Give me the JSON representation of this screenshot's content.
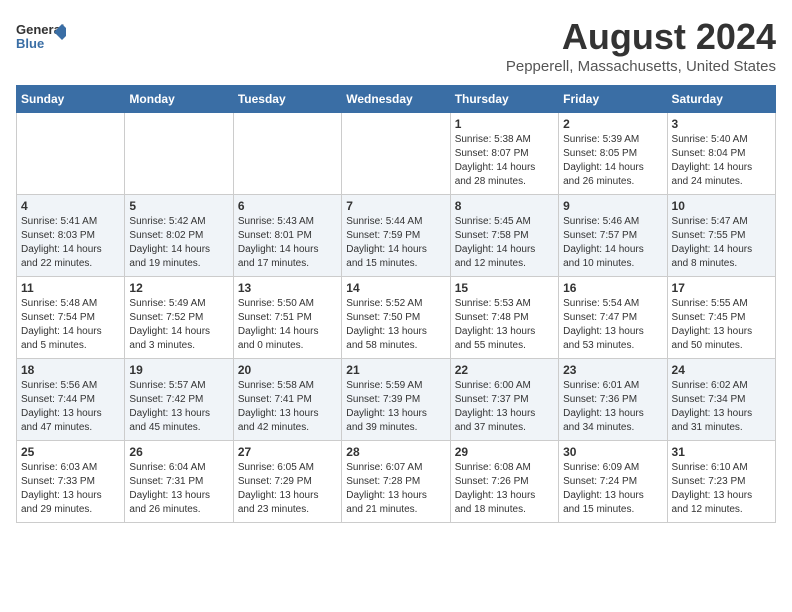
{
  "logo": {
    "text_general": "General",
    "text_blue": "Blue"
  },
  "header": {
    "title": "August 2024",
    "subtitle": "Pepperell, Massachusetts, United States"
  },
  "weekdays": [
    "Sunday",
    "Monday",
    "Tuesday",
    "Wednesday",
    "Thursday",
    "Friday",
    "Saturday"
  ],
  "weeks": [
    [
      {
        "day": "",
        "sunrise": "",
        "sunset": "",
        "daylight": ""
      },
      {
        "day": "",
        "sunrise": "",
        "sunset": "",
        "daylight": ""
      },
      {
        "day": "",
        "sunrise": "",
        "sunset": "",
        "daylight": ""
      },
      {
        "day": "",
        "sunrise": "",
        "sunset": "",
        "daylight": ""
      },
      {
        "day": "1",
        "sunrise": "Sunrise: 5:38 AM",
        "sunset": "Sunset: 8:07 PM",
        "daylight": "Daylight: 14 hours and 28 minutes."
      },
      {
        "day": "2",
        "sunrise": "Sunrise: 5:39 AM",
        "sunset": "Sunset: 8:05 PM",
        "daylight": "Daylight: 14 hours and 26 minutes."
      },
      {
        "day": "3",
        "sunrise": "Sunrise: 5:40 AM",
        "sunset": "Sunset: 8:04 PM",
        "daylight": "Daylight: 14 hours and 24 minutes."
      }
    ],
    [
      {
        "day": "4",
        "sunrise": "Sunrise: 5:41 AM",
        "sunset": "Sunset: 8:03 PM",
        "daylight": "Daylight: 14 hours and 22 minutes."
      },
      {
        "day": "5",
        "sunrise": "Sunrise: 5:42 AM",
        "sunset": "Sunset: 8:02 PM",
        "daylight": "Daylight: 14 hours and 19 minutes."
      },
      {
        "day": "6",
        "sunrise": "Sunrise: 5:43 AM",
        "sunset": "Sunset: 8:01 PM",
        "daylight": "Daylight: 14 hours and 17 minutes."
      },
      {
        "day": "7",
        "sunrise": "Sunrise: 5:44 AM",
        "sunset": "Sunset: 7:59 PM",
        "daylight": "Daylight: 14 hours and 15 minutes."
      },
      {
        "day": "8",
        "sunrise": "Sunrise: 5:45 AM",
        "sunset": "Sunset: 7:58 PM",
        "daylight": "Daylight: 14 hours and 12 minutes."
      },
      {
        "day": "9",
        "sunrise": "Sunrise: 5:46 AM",
        "sunset": "Sunset: 7:57 PM",
        "daylight": "Daylight: 14 hours and 10 minutes."
      },
      {
        "day": "10",
        "sunrise": "Sunrise: 5:47 AM",
        "sunset": "Sunset: 7:55 PM",
        "daylight": "Daylight: 14 hours and 8 minutes."
      }
    ],
    [
      {
        "day": "11",
        "sunrise": "Sunrise: 5:48 AM",
        "sunset": "Sunset: 7:54 PM",
        "daylight": "Daylight: 14 hours and 5 minutes."
      },
      {
        "day": "12",
        "sunrise": "Sunrise: 5:49 AM",
        "sunset": "Sunset: 7:52 PM",
        "daylight": "Daylight: 14 hours and 3 minutes."
      },
      {
        "day": "13",
        "sunrise": "Sunrise: 5:50 AM",
        "sunset": "Sunset: 7:51 PM",
        "daylight": "Daylight: 14 hours and 0 minutes."
      },
      {
        "day": "14",
        "sunrise": "Sunrise: 5:52 AM",
        "sunset": "Sunset: 7:50 PM",
        "daylight": "Daylight: 13 hours and 58 minutes."
      },
      {
        "day": "15",
        "sunrise": "Sunrise: 5:53 AM",
        "sunset": "Sunset: 7:48 PM",
        "daylight": "Daylight: 13 hours and 55 minutes."
      },
      {
        "day": "16",
        "sunrise": "Sunrise: 5:54 AM",
        "sunset": "Sunset: 7:47 PM",
        "daylight": "Daylight: 13 hours and 53 minutes."
      },
      {
        "day": "17",
        "sunrise": "Sunrise: 5:55 AM",
        "sunset": "Sunset: 7:45 PM",
        "daylight": "Daylight: 13 hours and 50 minutes."
      }
    ],
    [
      {
        "day": "18",
        "sunrise": "Sunrise: 5:56 AM",
        "sunset": "Sunset: 7:44 PM",
        "daylight": "Daylight: 13 hours and 47 minutes."
      },
      {
        "day": "19",
        "sunrise": "Sunrise: 5:57 AM",
        "sunset": "Sunset: 7:42 PM",
        "daylight": "Daylight: 13 hours and 45 minutes."
      },
      {
        "day": "20",
        "sunrise": "Sunrise: 5:58 AM",
        "sunset": "Sunset: 7:41 PM",
        "daylight": "Daylight: 13 hours and 42 minutes."
      },
      {
        "day": "21",
        "sunrise": "Sunrise: 5:59 AM",
        "sunset": "Sunset: 7:39 PM",
        "daylight": "Daylight: 13 hours and 39 minutes."
      },
      {
        "day": "22",
        "sunrise": "Sunrise: 6:00 AM",
        "sunset": "Sunset: 7:37 PM",
        "daylight": "Daylight: 13 hours and 37 minutes."
      },
      {
        "day": "23",
        "sunrise": "Sunrise: 6:01 AM",
        "sunset": "Sunset: 7:36 PM",
        "daylight": "Daylight: 13 hours and 34 minutes."
      },
      {
        "day": "24",
        "sunrise": "Sunrise: 6:02 AM",
        "sunset": "Sunset: 7:34 PM",
        "daylight": "Daylight: 13 hours and 31 minutes."
      }
    ],
    [
      {
        "day": "25",
        "sunrise": "Sunrise: 6:03 AM",
        "sunset": "Sunset: 7:33 PM",
        "daylight": "Daylight: 13 hours and 29 minutes."
      },
      {
        "day": "26",
        "sunrise": "Sunrise: 6:04 AM",
        "sunset": "Sunset: 7:31 PM",
        "daylight": "Daylight: 13 hours and 26 minutes."
      },
      {
        "day": "27",
        "sunrise": "Sunrise: 6:05 AM",
        "sunset": "Sunset: 7:29 PM",
        "daylight": "Daylight: 13 hours and 23 minutes."
      },
      {
        "day": "28",
        "sunrise": "Sunrise: 6:07 AM",
        "sunset": "Sunset: 7:28 PM",
        "daylight": "Daylight: 13 hours and 21 minutes."
      },
      {
        "day": "29",
        "sunrise": "Sunrise: 6:08 AM",
        "sunset": "Sunset: 7:26 PM",
        "daylight": "Daylight: 13 hours and 18 minutes."
      },
      {
        "day": "30",
        "sunrise": "Sunrise: 6:09 AM",
        "sunset": "Sunset: 7:24 PM",
        "daylight": "Daylight: 13 hours and 15 minutes."
      },
      {
        "day": "31",
        "sunrise": "Sunrise: 6:10 AM",
        "sunset": "Sunset: 7:23 PM",
        "daylight": "Daylight: 13 hours and 12 minutes."
      }
    ]
  ]
}
